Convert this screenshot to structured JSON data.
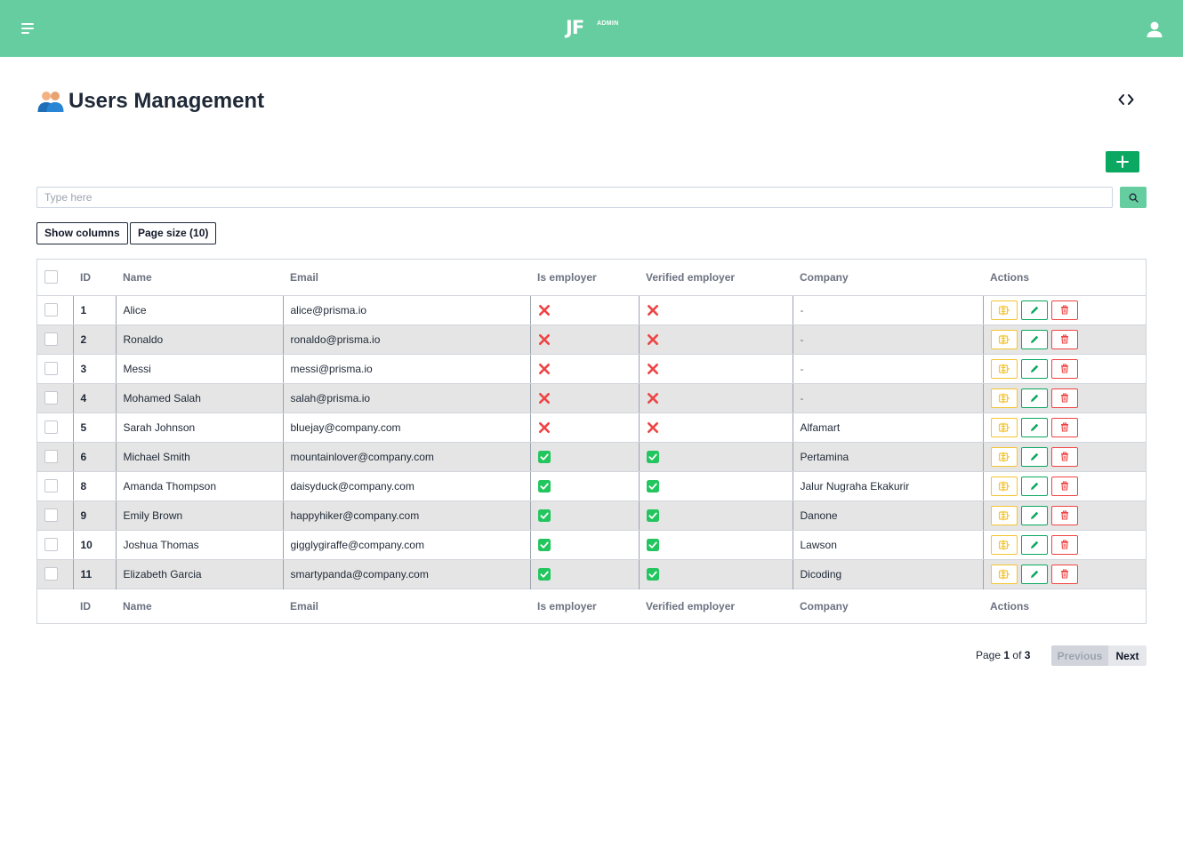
{
  "header": {
    "logo_text": "JF",
    "logo_badge": "ADMIN",
    "menu_icon": "hamburger-icon",
    "user_icon": "user-icon",
    "colors": {
      "topbar": "#66cda0"
    }
  },
  "page": {
    "title_icon": "users-icon",
    "title": "Users Management",
    "code_icon": "code-icon"
  },
  "toolbar": {
    "add_icon": "plus-icon",
    "search_placeholder": "Type here",
    "search_value": "",
    "search_icon": "search-icon",
    "show_columns_label": "Show columns",
    "page_size_label": "Page size (10)"
  },
  "table": {
    "columns": [
      "ID",
      "Name",
      "Email",
      "Is employer",
      "Verified employer",
      "Company",
      "Actions"
    ],
    "rows": [
      {
        "id": "1",
        "name": "Alice",
        "email": "alice@prisma.io",
        "is_employer": false,
        "verified": false,
        "company": "-"
      },
      {
        "id": "2",
        "name": "Ronaldo",
        "email": "ronaldo@prisma.io",
        "is_employer": false,
        "verified": false,
        "company": "-"
      },
      {
        "id": "3",
        "name": "Messi",
        "email": "messi@prisma.io",
        "is_employer": false,
        "verified": false,
        "company": "-"
      },
      {
        "id": "4",
        "name": "Mohamed Salah",
        "email": "salah@prisma.io",
        "is_employer": false,
        "verified": false,
        "company": "-"
      },
      {
        "id": "5",
        "name": "Sarah Johnson",
        "email": "bluejay@company.com",
        "is_employer": false,
        "verified": false,
        "company": "Alfamart"
      },
      {
        "id": "6",
        "name": "Michael Smith",
        "email": "mountainlover@company.com",
        "is_employer": true,
        "verified": true,
        "company": "Pertamina"
      },
      {
        "id": "8",
        "name": "Amanda Thompson",
        "email": "daisyduck@company.com",
        "is_employer": true,
        "verified": true,
        "company": "Jalur Nugraha Ekakurir"
      },
      {
        "id": "9",
        "name": "Emily Brown",
        "email": "happyhiker@company.com",
        "is_employer": true,
        "verified": true,
        "company": "Danone"
      },
      {
        "id": "10",
        "name": "Joshua Thomas",
        "email": "gigglygiraffe@company.com",
        "is_employer": true,
        "verified": true,
        "company": "Lawson"
      },
      {
        "id": "11",
        "name": "Elizabeth Garcia",
        "email": "smartypanda@company.com",
        "is_employer": true,
        "verified": true,
        "company": "Dicoding"
      }
    ],
    "action_icons": [
      "view-icon",
      "edit-icon",
      "delete-icon"
    ],
    "colors": {
      "true_mark": "#22c55e",
      "false_mark": "#ef4444",
      "view": "#f4c430",
      "edit": "#0aa860",
      "delete": "#ef4444",
      "stripe": "#e5e5e5"
    }
  },
  "pagination": {
    "page_label": "Page",
    "current_page": "1",
    "of_label": "of",
    "total_pages": "3",
    "previous_label": "Previous",
    "next_label": "Next"
  }
}
